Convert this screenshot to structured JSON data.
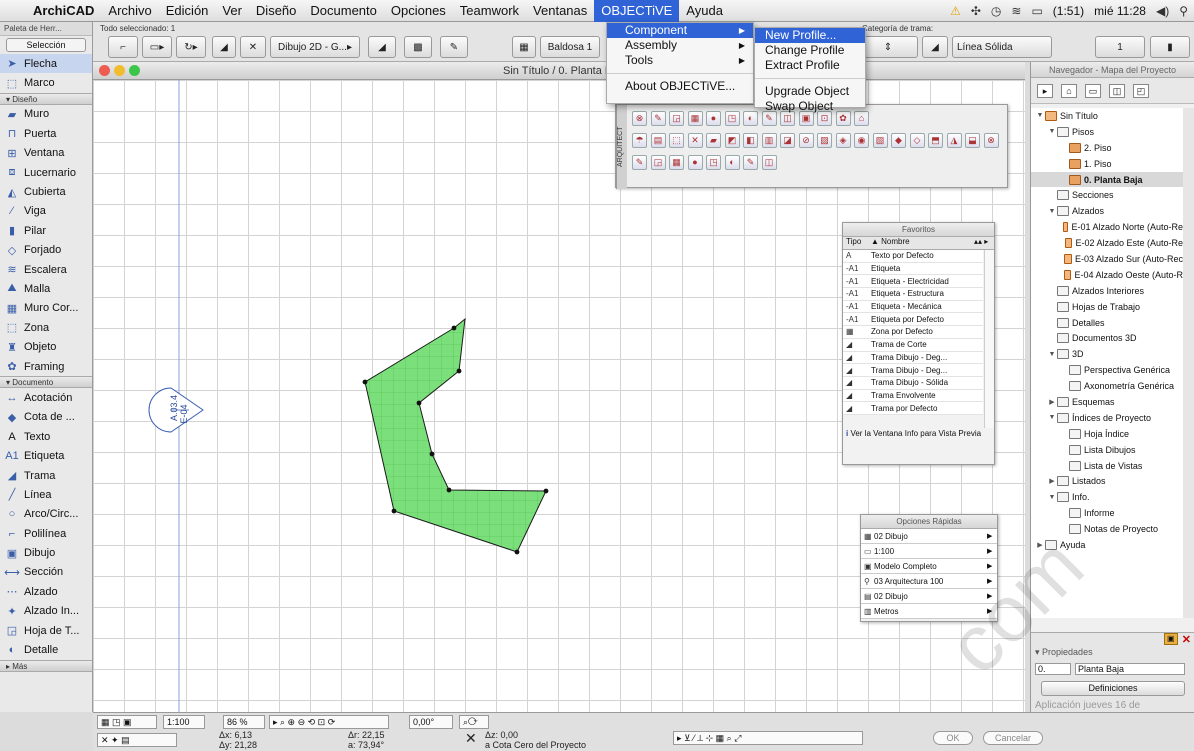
{
  "menubar": {
    "app": "ArchiCAD",
    "items": [
      "Archivo",
      "Edición",
      "Ver",
      "Diseño",
      "Documento",
      "Opciones",
      "Teamwork",
      "Ventanas",
      "OBJECTiVE",
      "Ayuda"
    ],
    "clock": "(1:51)",
    "datetime": "mié 11:28"
  },
  "infobox": {
    "palette_title": "Paleta de Herr...",
    "selection_label": "Selección",
    "all_selected": "Todo seleccionado: 1",
    "drawing_combo": "Dibujo 2D - G...",
    "tile_label": "Baldosa 1",
    "line_label": "Línea Sólida",
    "line_category": "Categoría de trama:",
    "pen_value": "1"
  },
  "toolbox": {
    "tools_top": [
      "Flecha",
      "Marco"
    ],
    "section_design": "Diseño",
    "design_tools": [
      "Muro",
      "Puerta",
      "Ventana",
      "Lucernario",
      "Cubierta",
      "Viga",
      "Pilar",
      "Forjado",
      "Escalera",
      "Malla",
      "Muro Cor...",
      "Zona",
      "Objeto",
      "Framing"
    ],
    "section_document": "Documento",
    "document_tools": [
      "Acotación",
      "Cota de ...",
      "Texto",
      "Etiqueta",
      "Trama",
      "Línea",
      "Arco/Circ...",
      "Polilínea",
      "Dibujo",
      "Sección",
      "Alzado",
      "Alzado In...",
      "Hoja de T...",
      "Detalle"
    ],
    "more": "Más"
  },
  "canvas": {
    "title": "Sin Título / 0. Planta B",
    "marker_top": "A.03.4",
    "marker_bottom": "E-04"
  },
  "objective_menu": {
    "items": [
      "Component",
      "Assembly",
      "Tools",
      "About OBJECTiVE..."
    ],
    "submenu": [
      "New Profile...",
      "Change Profile",
      "Extract Profile",
      "Upgrade Object",
      "Swap Object"
    ]
  },
  "palette": {
    "side_label": "ARQUITECT"
  },
  "favorites": {
    "title": "Favoritos",
    "col_tipo": "Tipo",
    "col_nombre": "▲ Nombre",
    "rows": [
      {
        "icon": "A",
        "name": "Texto por Defecto"
      },
      {
        "icon": "-A1",
        "name": "Etiqueta"
      },
      {
        "icon": "-A1",
        "name": "Etiqueta - Electricidad"
      },
      {
        "icon": "-A1",
        "name": "Etiqueta - Estructura"
      },
      {
        "icon": "-A1",
        "name": "Etiqueta - Mecánica"
      },
      {
        "icon": "-A1",
        "name": "Etiqueta por Defecto"
      },
      {
        "icon": "▦",
        "name": "Zona por Defecto"
      },
      {
        "icon": "◢",
        "name": "Trama de Corte"
      },
      {
        "icon": "◢",
        "name": "Trama Dibujo - Deg..."
      },
      {
        "icon": "◢",
        "name": "Trama Dibujo - Deg..."
      },
      {
        "icon": "◢",
        "name": "Trama Dibujo - Sólida"
      },
      {
        "icon": "◢",
        "name": "Trama Envolvente"
      },
      {
        "icon": "◢",
        "name": "Trama por Defecto"
      }
    ],
    "note": "Ver la Ventana Info para Vista Previa"
  },
  "quick": {
    "title": "Opciones Rápidas",
    "rows": [
      "02 Dibujo",
      "1:100",
      "Modelo Completo",
      "03 Arquitectura 100",
      "02 Dibujo",
      "Metros"
    ]
  },
  "navigator": {
    "title": "Navegador - Mapa del Proyecto",
    "tree": [
      {
        "t": "Sin Título",
        "lvl": 0,
        "tw": "▼",
        "ic": "house"
      },
      {
        "t": "Pisos",
        "lvl": 1,
        "tw": "▼",
        "ic": "box"
      },
      {
        "t": "2. Piso",
        "lvl": 2,
        "tw": "",
        "ic": "folder"
      },
      {
        "t": "1. Piso",
        "lvl": 2,
        "tw": "",
        "ic": "folder"
      },
      {
        "t": "0. Planta Baja",
        "lvl": 2,
        "tw": "",
        "ic": "folder",
        "bold": true
      },
      {
        "t": "Secciones",
        "lvl": 1,
        "tw": "",
        "ic": "box"
      },
      {
        "t": "Alzados",
        "lvl": 1,
        "tw": "▼",
        "ic": "box"
      },
      {
        "t": "E-01 Alzado Norte (Auto-Re",
        "lvl": 2,
        "tw": "",
        "ic": "house"
      },
      {
        "t": "E-02 Alzado Este (Auto-Re",
        "lvl": 2,
        "tw": "",
        "ic": "house"
      },
      {
        "t": "E-03 Alzado Sur (Auto-Rec",
        "lvl": 2,
        "tw": "",
        "ic": "house"
      },
      {
        "t": "E-04 Alzado Oeste (Auto-R",
        "lvl": 2,
        "tw": "",
        "ic": "house"
      },
      {
        "t": "Alzados Interiores",
        "lvl": 1,
        "tw": "",
        "ic": "box"
      },
      {
        "t": "Hojas de Trabajo",
        "lvl": 1,
        "tw": "",
        "ic": "box"
      },
      {
        "t": "Detalles",
        "lvl": 1,
        "tw": "",
        "ic": "box"
      },
      {
        "t": "Documentos 3D",
        "lvl": 1,
        "tw": "",
        "ic": "box"
      },
      {
        "t": "3D",
        "lvl": 1,
        "tw": "▼",
        "ic": "box"
      },
      {
        "t": "Perspectiva Genérica",
        "lvl": 2,
        "tw": "",
        "ic": "box"
      },
      {
        "t": "Axonometría Genérica",
        "lvl": 2,
        "tw": "",
        "ic": "box"
      },
      {
        "t": "Esquemas",
        "lvl": 1,
        "tw": "▶",
        "ic": "box"
      },
      {
        "t": "Índices de Proyecto",
        "lvl": 1,
        "tw": "▼",
        "ic": "box"
      },
      {
        "t": "Hoja Índice",
        "lvl": 2,
        "tw": "",
        "ic": "box"
      },
      {
        "t": "Lista Dibujos",
        "lvl": 2,
        "tw": "",
        "ic": "box"
      },
      {
        "t": "Lista de Vistas",
        "lvl": 2,
        "tw": "",
        "ic": "box"
      },
      {
        "t": "Listados",
        "lvl": 1,
        "tw": "▶",
        "ic": "box"
      },
      {
        "t": "Info.",
        "lvl": 1,
        "tw": "▼",
        "ic": "box"
      },
      {
        "t": "Informe",
        "lvl": 2,
        "tw": "",
        "ic": "box"
      },
      {
        "t": "Notas de Proyecto",
        "lvl": 2,
        "tw": "",
        "ic": "box"
      },
      {
        "t": "Ayuda",
        "lvl": 0,
        "tw": "▶",
        "ic": "box"
      }
    ],
    "props_title": "Propiedades",
    "props_num": "0.",
    "props_name": "Planta Baja",
    "props_btn": "Definiciones",
    "app_footer": "Aplicación  jueves 16 de"
  },
  "statusbar": {
    "scale": "1:100",
    "zoom": "86 %",
    "angle": "0,00°",
    "dx": "Δx: 6,13",
    "dy": "Δy: 21,28",
    "dr": "Δr: 22,15",
    "da": "a: 73,94°",
    "dz": "Δz: 0,00",
    "zref": "a Cota Cero del Proyecto",
    "ok": "OK",
    "cancel": "Cancelar"
  },
  "watermark": "com",
  "colors": {
    "accent": "#2f63d6",
    "shape_fill": "#7be07b",
    "shape_stroke": "#1a1a1a"
  }
}
